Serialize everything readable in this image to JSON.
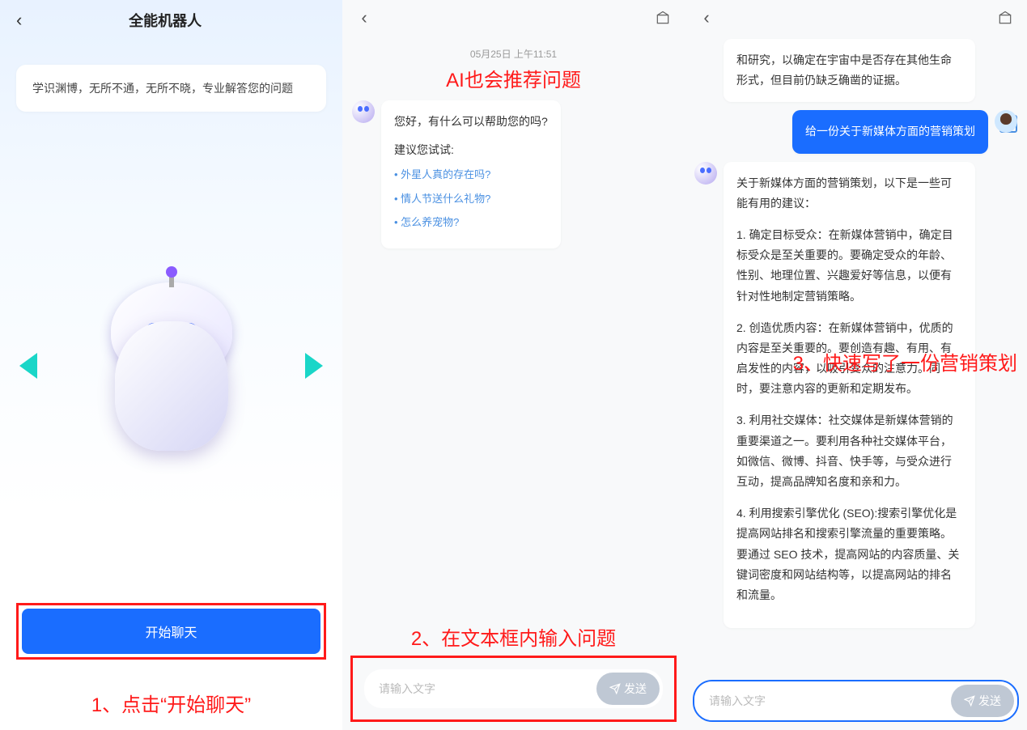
{
  "panel1": {
    "title": "全能机器人",
    "card_text": "学识渊博，无所不通，无所不晓，专业解答您的问题",
    "start_button": "开始聊天",
    "caption": "1、点击“开始聊天”"
  },
  "panel2": {
    "timestamp": "05月25日 上午11:51",
    "overlay_top": "AI也会推荐问题",
    "greeting": "您好，有什么可以帮助您的吗?",
    "suggestion_title": "建议您试试:",
    "suggestions": {
      "s0": "外星人真的存在吗?",
      "s1": "情人节送什么礼物?",
      "s2": "怎么养宠物?"
    },
    "input_placeholder": "请输入文字",
    "send_label": "发送",
    "caption": "2、在文本框内输入问题"
  },
  "panel3": {
    "bot_reply_top": "和研究，以确定在宇宙中是否存在其他生命形式，但目前仍缺乏确凿的证据。",
    "user_msg": "给一份关于新媒体方面的营销策划",
    "overlay": "3、快速写了一份营销策划",
    "long_intro": "关于新媒体方面的营销策划，以下是一些可能有用的建议：",
    "long_p1": "1. 确定目标受众：在新媒体营销中，确定目标受众是至关重要的。要确定受众的年龄、性别、地理位置、兴趣爱好等信息，以便有针对性地制定营销策略。",
    "long_p2": "2. 创造优质内容：在新媒体营销中，优质的内容是至关重要的。要创造有趣、有用、有启发性的内容，以吸引受众的注意力。同时，要注意内容的更新和定期发布。",
    "long_p3": "3. 利用社交媒体：社交媒体是新媒体营销的重要渠道之一。要利用各种社交媒体平台，如微信、微博、抖音、快手等，与受众进行互动，提高品牌知名度和亲和力。",
    "long_p4": "4. 利用搜索引擎优化 (SEO):搜索引擎优化是提高网站排名和搜索引擎流量的重要策略。要通过 SEO 技术，提高网站的内容质量、关键词密度和网站结构等，以提高网站的排名和流量。",
    "input_placeholder": "请输入文字",
    "send_label": "发送"
  }
}
